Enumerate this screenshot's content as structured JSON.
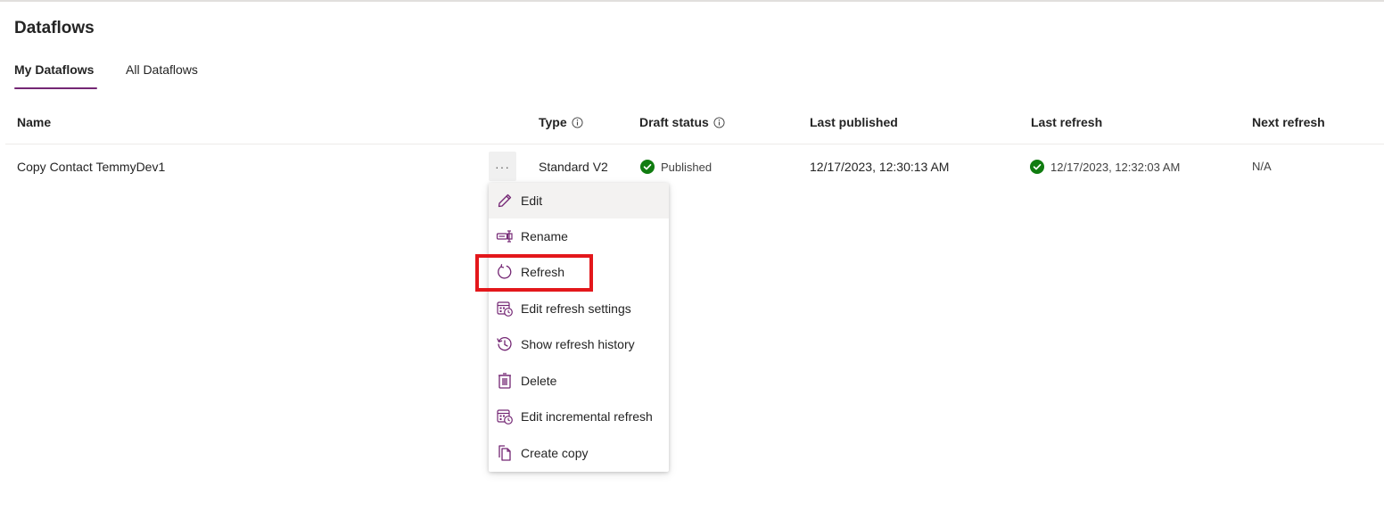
{
  "page": {
    "title": "Dataflows"
  },
  "tabs": [
    {
      "label": "My Dataflows",
      "active": true
    },
    {
      "label": "All Dataflows",
      "active": false
    }
  ],
  "table": {
    "columns": {
      "name": "Name",
      "type": "Type",
      "draft_status": "Draft status",
      "last_published": "Last published",
      "last_refresh": "Last refresh",
      "next_refresh": "Next refresh"
    },
    "rows": [
      {
        "name": "Copy Contact TemmyDev1",
        "more_label": "···",
        "type": "Standard V2",
        "draft_status": "Published",
        "last_published": "12/17/2023, 12:30:13 AM",
        "last_refresh": "12/17/2023, 12:32:03 AM",
        "next_refresh": "N/A"
      }
    ]
  },
  "context_menu": {
    "items": [
      {
        "label": "Edit",
        "icon": "pencil-icon"
      },
      {
        "label": "Rename",
        "icon": "rename-icon"
      },
      {
        "label": "Refresh",
        "icon": "refresh-icon"
      },
      {
        "label": "Edit refresh settings",
        "icon": "calendar-clock-icon"
      },
      {
        "label": "Show refresh history",
        "icon": "history-icon"
      },
      {
        "label": "Delete",
        "icon": "trash-icon"
      },
      {
        "label": "Edit incremental refresh",
        "icon": "calendar-clock-icon"
      },
      {
        "label": "Create copy",
        "icon": "copy-icon"
      }
    ]
  },
  "colors": {
    "accent": "#742774",
    "success": "#107c10",
    "highlight": "#e3171b"
  }
}
